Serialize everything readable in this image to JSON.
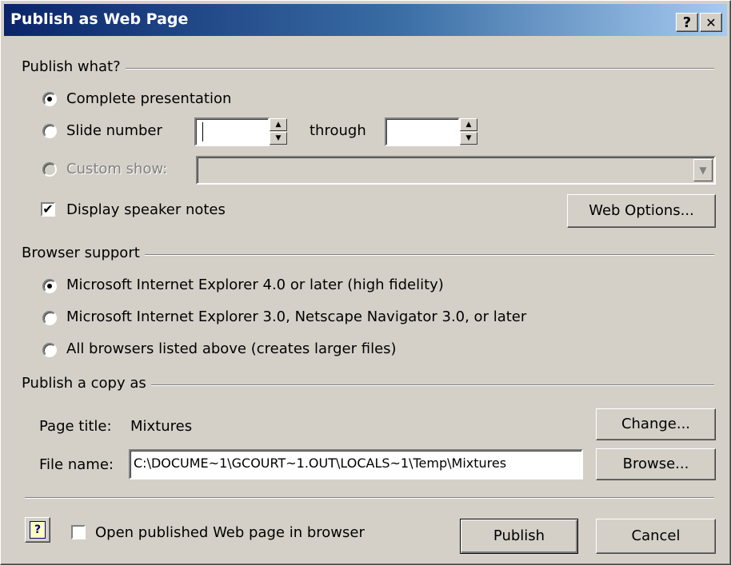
{
  "window": {
    "title": "Publish as Web Page",
    "help_glyph": "?",
    "close_glyph": "✕"
  },
  "publish_what": {
    "heading": "Publish what?",
    "complete_label": "Complete presentation",
    "slide_number_label": "Slide number",
    "slide_from_value": "",
    "through_label": "through",
    "slide_to_value": "",
    "custom_show_label": "Custom show:",
    "custom_show_value": "",
    "display_notes_label": "Display speaker notes",
    "display_notes_checked": true,
    "web_options_label": "Web Options..."
  },
  "browser_support": {
    "heading": "Browser support",
    "options": [
      {
        "label": "Microsoft Internet Explorer 4.0 or later (high fidelity)",
        "selected": true
      },
      {
        "label": "Microsoft Internet Explorer 3.0, Netscape Navigator 3.0, or later",
        "selected": false
      },
      {
        "label": "All browsers listed above (creates larger files)",
        "selected": false
      }
    ]
  },
  "publish_copy": {
    "heading": "Publish a copy as",
    "page_title_label": "Page title:",
    "page_title_value": "Mixtures",
    "change_label": "Change...",
    "file_name_label": "File name:",
    "file_name_value": "C:\\DOCUME~1\\GCOURT~1.OUT\\LOCALS~1\\Temp\\Mixtures",
    "browse_label": "Browse..."
  },
  "footer": {
    "help_icon_glyph": "?",
    "open_in_browser_label": "Open published Web page in browser",
    "open_in_browser_checked": false,
    "publish_label": "Publish",
    "cancel_label": "Cancel"
  }
}
